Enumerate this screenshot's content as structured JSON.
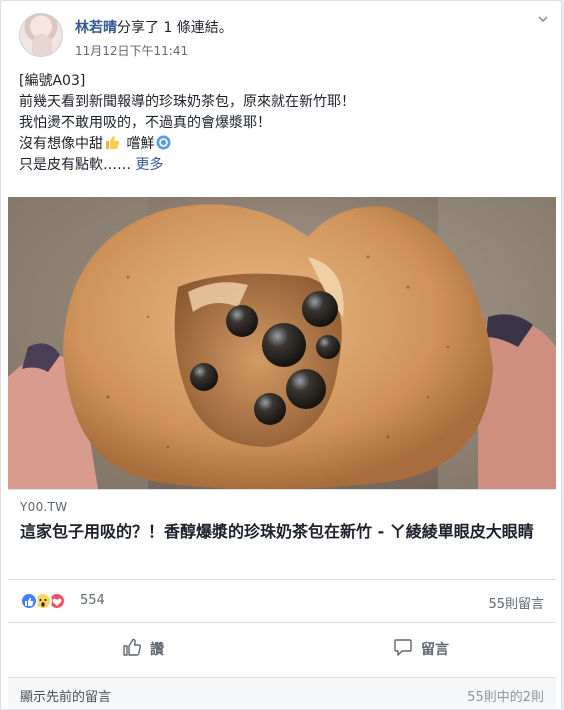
{
  "post": {
    "author": "林若晴",
    "action": "分享了 1 條連結。",
    "timestamp": "11月12日下午11:41",
    "menu_icon": "chevron-down-icon",
    "body_lines": [
      "[編號A03]",
      "前幾天看到新聞報導的珍珠奶茶包，原來就在新竹耶！",
      "我怕燙不敢用吸的，不過真的會爆漿耶！"
    ],
    "line4_text": "沒有想像中甜",
    "line4_emoji": "thumbs-up-icon",
    "line4_text2": " 嚐鮮",
    "line4_emoji2": "ok-icon",
    "line5_text": "只是皮有點軟…… ",
    "see_more": "更多"
  },
  "link": {
    "domain": "Y00.TW",
    "title": "這家包子用吸的？！香醇爆漿的珍珠奶茶包在新竹 - ㄚ綾綾單眼皮大眼睛",
    "image": "bubble-tea-bun-photo"
  },
  "stats": {
    "reactions": [
      "like-icon",
      "wow-icon",
      "love-icon"
    ],
    "reaction_count": "554",
    "comment_count": "55則留言"
  },
  "actions": {
    "like_label": "讚",
    "comment_label": "留言"
  },
  "footer": {
    "prev_comments": "顯示先前的留言",
    "page_count": "55則中的2則"
  },
  "colors": {
    "link_blue": "#365899",
    "text": "#1d2129",
    "muted": "#606770",
    "border": "#dddfe2"
  }
}
